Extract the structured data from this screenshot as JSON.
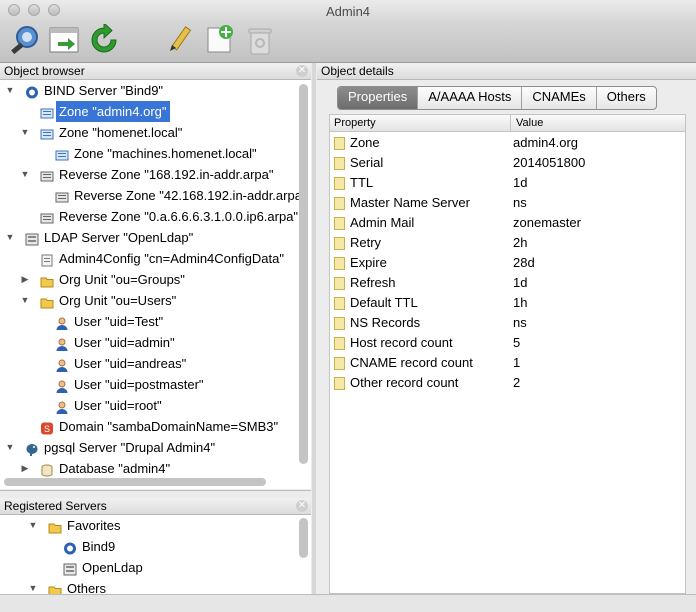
{
  "window": {
    "title": "Admin4"
  },
  "toolbar": {
    "icons": [
      "connect-icon",
      "register-server-icon",
      "refresh-icon",
      "edit-icon",
      "new-object-icon",
      "delete-icon"
    ]
  },
  "object_browser": {
    "title": "Object browser",
    "items": [
      {
        "label": "BIND Server \"Bind9\"",
        "icon": "server-icon",
        "expand": "open"
      },
      {
        "label": "Zone \"admin4.org\"",
        "icon": "zone-icon",
        "expand": "none",
        "selected": true
      },
      {
        "label": "Zone \"homenet.local\"",
        "icon": "zone-icon",
        "expand": "open"
      },
      {
        "label": "Zone \"machines.homenet.local\"",
        "icon": "zone-icon",
        "expand": "none"
      },
      {
        "label": "Reverse Zone \"168.192.in-addr.arpa\"",
        "icon": "reverse-zone-icon",
        "expand": "open"
      },
      {
        "label": "Reverse Zone \"42.168.192.in-addr.arpa\"",
        "icon": "reverse-zone-icon",
        "expand": "none"
      },
      {
        "label": "Reverse Zone \"0.a.6.6.6.3.1.0.0.ip6.arpa\"",
        "icon": "reverse-zone-icon",
        "expand": "none"
      },
      {
        "label": "LDAP Server \"OpenLdap\"",
        "icon": "ldap-server-icon",
        "expand": "open"
      },
      {
        "label": "Admin4Config \"cn=Admin4ConfigData\"",
        "icon": "config-icon",
        "expand": "none"
      },
      {
        "label": "Org Unit \"ou=Groups\"",
        "icon": "folder-icon",
        "expand": "closed"
      },
      {
        "label": "Org Unit \"ou=Users\"",
        "icon": "folder-icon",
        "expand": "open"
      },
      {
        "label": "User \"uid=Test\"",
        "icon": "user-icon",
        "expand": "none"
      },
      {
        "label": "User \"uid=admin\"",
        "icon": "user-icon",
        "expand": "none"
      },
      {
        "label": "User \"uid=andreas\"",
        "icon": "user-icon",
        "expand": "none"
      },
      {
        "label": "User \"uid=postmaster\"",
        "icon": "user-icon",
        "expand": "none"
      },
      {
        "label": "User \"uid=root\"",
        "icon": "user-icon",
        "expand": "none"
      },
      {
        "label": "Domain \"sambaDomainName=SMB3\"",
        "icon": "samba-domain-icon",
        "expand": "none"
      },
      {
        "label": "pgsql Server \"Drupal Admin4\"",
        "icon": "postgres-elephant-icon",
        "expand": "open"
      },
      {
        "label": "Database \"admin4\"",
        "icon": "database-icon",
        "expand": "closed"
      }
    ]
  },
  "registered_servers": {
    "title": "Registered Servers",
    "items": [
      {
        "label": "Favorites",
        "icon": "folder-icon",
        "expand": "open"
      },
      {
        "label": "Bind9",
        "icon": "server-icon",
        "expand": "none"
      },
      {
        "label": "OpenLdap",
        "icon": "ldap-server-icon",
        "expand": "none"
      },
      {
        "label": "Others",
        "icon": "folder-icon",
        "expand": "open"
      }
    ]
  },
  "object_details": {
    "title": "Object details",
    "tabs": [
      "Properties",
      "A/AAAA Hosts",
      "CNAMEs",
      "Others"
    ],
    "active_tab": "Properties",
    "columns": [
      "Property",
      "Value"
    ],
    "rows": [
      {
        "property": "Zone",
        "value": "admin4.org"
      },
      {
        "property": "Serial",
        "value": "2014051800"
      },
      {
        "property": "TTL",
        "value": "1d"
      },
      {
        "property": "Master Name Server",
        "value": "ns"
      },
      {
        "property": "Admin Mail",
        "value": "zonemaster"
      },
      {
        "property": "Retry",
        "value": "2h"
      },
      {
        "property": "Expire",
        "value": "28d"
      },
      {
        "property": "Refresh",
        "value": "1d"
      },
      {
        "property": "Default TTL",
        "value": "1h"
      },
      {
        "property": "NS Records",
        "value": "ns"
      },
      {
        "property": "Host record count",
        "value": "5"
      },
      {
        "property": "CNAME record count",
        "value": "1"
      },
      {
        "property": "Other record count",
        "value": "2"
      }
    ]
  },
  "colors": {
    "selection": "#3875d7",
    "toolbar": "#c8c8c8"
  }
}
